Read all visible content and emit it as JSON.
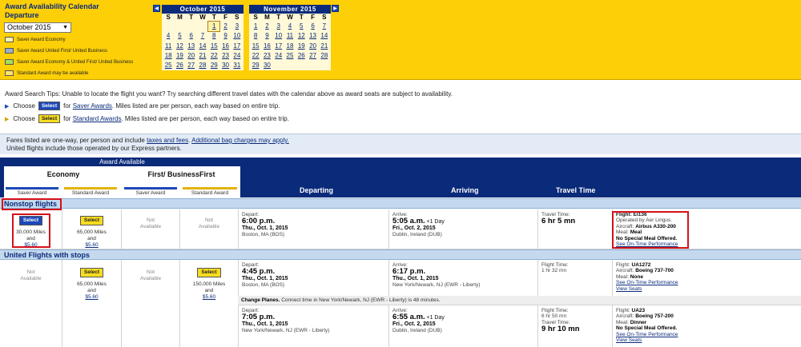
{
  "calendar": {
    "title_line1": "Award Availability Calendar",
    "title_line2": "Departure",
    "month_select": "October 2015",
    "legend": [
      {
        "label": "Saver Award Economy",
        "color": "#fff3b0"
      },
      {
        "label": "Saver Award United First/ United Business",
        "color": "#9aaecd"
      },
      {
        "label": "Saver Award Economy & United First/ United Business",
        "color": "#a7df5b"
      },
      {
        "label": "Standard Award may be available",
        "color": "#fde16e"
      }
    ],
    "dow": [
      "S",
      "M",
      "T",
      "W",
      "T",
      "F",
      "S"
    ],
    "months": [
      {
        "name": "October 2015",
        "weeks": [
          [
            "",
            "",
            "",
            "",
            "1",
            "2",
            "3"
          ],
          [
            "4",
            "5",
            "6",
            "7",
            "8",
            "9",
            "10"
          ],
          [
            "11",
            "12",
            "13",
            "14",
            "15",
            "16",
            "17"
          ],
          [
            "18",
            "19",
            "20",
            "21",
            "22",
            "23",
            "24"
          ],
          [
            "25",
            "26",
            "27",
            "28",
            "29",
            "30",
            "31"
          ]
        ]
      },
      {
        "name": "November 2015",
        "weeks": [
          [
            "1",
            "2",
            "3",
            "4",
            "5",
            "6",
            "7"
          ],
          [
            "8",
            "9",
            "10",
            "11",
            "12",
            "13",
            "14"
          ],
          [
            "15",
            "16",
            "17",
            "18",
            "19",
            "20",
            "21"
          ],
          [
            "22",
            "23",
            "24",
            "25",
            "26",
            "27",
            "28"
          ],
          [
            "29",
            "30",
            "",
            "",
            "",
            "",
            ""
          ]
        ]
      }
    ],
    "selected_day": "1"
  },
  "tips": {
    "line": "Award Search Tips: Unable to locate the flight you want? Try searching different travel dates with the calendar above as award seats are subject to availability.",
    "saver_pre": "Choose",
    "saver_btn": "Select",
    "saver_for": "for",
    "saver_link": "Saver Awards",
    "saver_post": ". Miles listed are per person, each way based on entire trip.",
    "std_pre": "Choose",
    "std_btn": "Select",
    "std_for": "for",
    "std_link": "Standard Awards",
    "std_post": ". Miles listed are per person, each way based on entire trip."
  },
  "fares": {
    "pre": "Fares listed are one-way, per person and include",
    "link1": "taxes and fees",
    "link2": "Additional bag charges may apply.",
    "line2": "United flights include those operated by our Express partners."
  },
  "header": {
    "award_available": "Award Available",
    "economy": "Economy",
    "first": "First/ BusinessFirst",
    "chips": [
      "Saver Award",
      "Standard Award",
      "Saver Award",
      "Standard Award"
    ],
    "departing": "Departing",
    "arriving": "Arriving",
    "travel_time": "Travel Time"
  },
  "sections": {
    "nonstop": "Nonstop flights",
    "stops": "United Flights with stops"
  },
  "flights": {
    "f1": {
      "eco_saver_btn": "Select",
      "eco_saver_miles": "30,000 Miles",
      "eco_saver_and": "and",
      "eco_saver_fee": "$5.60",
      "eco_std_btn": "Select",
      "eco_std_miles": "65,000 Miles",
      "eco_std_and": "and",
      "eco_std_fee": "$5.60",
      "first_saver_na1": "Not",
      "first_saver_na2": "Available",
      "first_std_na1": "Not",
      "first_std_na2": "Available",
      "dep_label": "Depart:",
      "dep_time": "6:00 p.m.",
      "dep_date": "Thu., Oct. 1, 2015",
      "dep_city": "Boston, MA (BOS)",
      "arr_label": "Arrive:",
      "arr_time": "5:05 a.m.",
      "arr_plus": "+1 Day",
      "arr_date": "Fri., Oct. 2, 2015",
      "arr_city": "Dublin, Ireland (DUB)",
      "tt_label": "Travel Time:",
      "tt_value": "6 hr 5 mn",
      "flight": "Flight: EI136",
      "operated": "Operated by Aer Lingus.",
      "aircraft_label": "Aircraft:",
      "aircraft": "Airbus A330-200",
      "meal_label": "Meal:",
      "meal": "Meal",
      "special": "No Special Meal Offered.",
      "ontime": "See On-Time Performance"
    },
    "f2": {
      "eco_saver_na1": "Not",
      "eco_saver_na2": "Available",
      "eco_std_btn": "Select",
      "eco_std_miles": "65,000 Miles",
      "eco_std_and": "and",
      "eco_std_fee": "$5.60",
      "first_saver_na1": "Not",
      "first_saver_na2": "Available",
      "first_std_btn": "Select",
      "first_std_miles": "150,000 Miles",
      "first_std_and": "and",
      "first_std_fee": "$5.60",
      "dep_label": "Depart:",
      "dep_time": "4:45 p.m.",
      "dep_date": "Thu., Oct. 1, 2015",
      "dep_city": "Boston, MA (BOS)",
      "arr_label": "Arrive:",
      "arr_time": "6:17 p.m.",
      "arr_date": "Thu., Oct. 1, 2015",
      "arr_city": "New York/Newark, NJ (EWR - Liberty)",
      "ft_label": "Flight Time:",
      "ft_value": "1 hr 32 mn",
      "flight_label": "Flight:",
      "flight": "UA1272",
      "aircraft_label": "Aircraft:",
      "aircraft": "Boeing 737-700",
      "meal_label": "Meal:",
      "meal": "None",
      "ontime": "See On-Time Performance",
      "seats": "View Seats",
      "change_bold": "Change Planes.",
      "change_text": "Connect time in New York/Newark, NJ (EWR - Liberty) is 48 minutes."
    },
    "f3": {
      "dep_label": "Depart:",
      "dep_time": "7:05 p.m.",
      "dep_date": "Thu., Oct. 1, 2015",
      "dep_city": "New York/Newark, NJ (EWR - Liberty)",
      "arr_label": "Arrive:",
      "arr_time": "6:55 a.m.",
      "arr_plus": "+1 Day",
      "arr_date": "Fri., Oct. 2, 2015",
      "arr_city": "Dublin, Ireland (DUB)",
      "ft_label": "Flight Time:",
      "ft_value": "6 hr 50 mn",
      "tt_label": "Travel Time:",
      "tt_value": "9 hr 10 mn",
      "flight_label": "Flight:",
      "flight": "UA23",
      "aircraft_label": "Aircraft:",
      "aircraft": "Boeing 757-200",
      "meal_label": "Meal:",
      "meal": "Dinner",
      "special": "No Special Meal Offered.",
      "ontime": "See On-Time Performance",
      "seats": "View Seats"
    }
  }
}
